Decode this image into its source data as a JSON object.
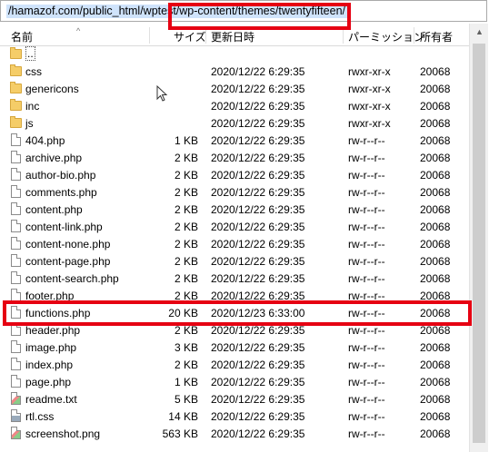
{
  "path_bar": {
    "path": "/hamazof.com/public_html/wptest/wp-content/themes/twentyfifteen/"
  },
  "columns": {
    "name": "名前",
    "size": "サイズ",
    "modified": "更新日時",
    "permissions": "パーミッション",
    "owner": "所有者"
  },
  "rows": [
    {
      "name": "..",
      "size": "",
      "modified": "",
      "permissions": "",
      "owner": "",
      "type": "parent"
    },
    {
      "name": "css",
      "size": "",
      "modified": "2020/12/22 6:29:35",
      "permissions": "rwxr-xr-x",
      "owner": "20068",
      "type": "folder"
    },
    {
      "name": "genericons",
      "size": "",
      "modified": "2020/12/22 6:29:35",
      "permissions": "rwxr-xr-x",
      "owner": "20068",
      "type": "folder"
    },
    {
      "name": "inc",
      "size": "",
      "modified": "2020/12/22 6:29:35",
      "permissions": "rwxr-xr-x",
      "owner": "20068",
      "type": "folder"
    },
    {
      "name": "js",
      "size": "",
      "modified": "2020/12/22 6:29:35",
      "permissions": "rwxr-xr-x",
      "owner": "20068",
      "type": "folder"
    },
    {
      "name": "404.php",
      "size": "1 KB",
      "modified": "2020/12/22 6:29:35",
      "permissions": "rw-r--r--",
      "owner": "20068",
      "type": "file"
    },
    {
      "name": "archive.php",
      "size": "2 KB",
      "modified": "2020/12/22 6:29:35",
      "permissions": "rw-r--r--",
      "owner": "20068",
      "type": "file"
    },
    {
      "name": "author-bio.php",
      "size": "2 KB",
      "modified": "2020/12/22 6:29:35",
      "permissions": "rw-r--r--",
      "owner": "20068",
      "type": "file"
    },
    {
      "name": "comments.php",
      "size": "2 KB",
      "modified": "2020/12/22 6:29:35",
      "permissions": "rw-r--r--",
      "owner": "20068",
      "type": "file"
    },
    {
      "name": "content.php",
      "size": "2 KB",
      "modified": "2020/12/22 6:29:35",
      "permissions": "rw-r--r--",
      "owner": "20068",
      "type": "file"
    },
    {
      "name": "content-link.php",
      "size": "2 KB",
      "modified": "2020/12/22 6:29:35",
      "permissions": "rw-r--r--",
      "owner": "20068",
      "type": "file"
    },
    {
      "name": "content-none.php",
      "size": "2 KB",
      "modified": "2020/12/22 6:29:35",
      "permissions": "rw-r--r--",
      "owner": "20068",
      "type": "file"
    },
    {
      "name": "content-page.php",
      "size": "2 KB",
      "modified": "2020/12/22 6:29:35",
      "permissions": "rw-r--r--",
      "owner": "20068",
      "type": "file"
    },
    {
      "name": "content-search.php",
      "size": "2 KB",
      "modified": "2020/12/22 6:29:35",
      "permissions": "rw-r--r--",
      "owner": "20068",
      "type": "file"
    },
    {
      "name": "footer.php",
      "size": "2 KB",
      "modified": "2020/12/22 6:29:35",
      "permissions": "rw-r--r--",
      "owner": "20068",
      "type": "file"
    },
    {
      "name": "functions.php",
      "size": "20 KB",
      "modified": "2020/12/23 6:33:00",
      "permissions": "rw-r--r--",
      "owner": "20068",
      "type": "file"
    },
    {
      "name": "header.php",
      "size": "2 KB",
      "modified": "2020/12/22 6:29:35",
      "permissions": "rw-r--r--",
      "owner": "20068",
      "type": "file"
    },
    {
      "name": "image.php",
      "size": "3 KB",
      "modified": "2020/12/22 6:29:35",
      "permissions": "rw-r--r--",
      "owner": "20068",
      "type": "file"
    },
    {
      "name": "index.php",
      "size": "2 KB",
      "modified": "2020/12/22 6:29:35",
      "permissions": "rw-r--r--",
      "owner": "20068",
      "type": "file"
    },
    {
      "name": "page.php",
      "size": "1 KB",
      "modified": "2020/12/22 6:29:35",
      "permissions": "rw-r--r--",
      "owner": "20068",
      "type": "file"
    },
    {
      "name": "readme.txt",
      "size": "5 KB",
      "modified": "2020/12/22 6:29:35",
      "permissions": "rw-r--r--",
      "owner": "20068",
      "type": "file-image"
    },
    {
      "name": "rtl.css",
      "size": "14 KB",
      "modified": "2020/12/22 6:29:35",
      "permissions": "rw-r--r--",
      "owner": "20068",
      "type": "file-css"
    },
    {
      "name": "screenshot.png",
      "size": "563 KB",
      "modified": "2020/12/22 6:29:35",
      "permissions": "rw-r--r--",
      "owner": "20068",
      "type": "file-image"
    }
  ],
  "highlight_color": "#e60012",
  "icons": {
    "parent": "folder-up-icon",
    "folder": "folder-icon",
    "file": "file-icon"
  }
}
